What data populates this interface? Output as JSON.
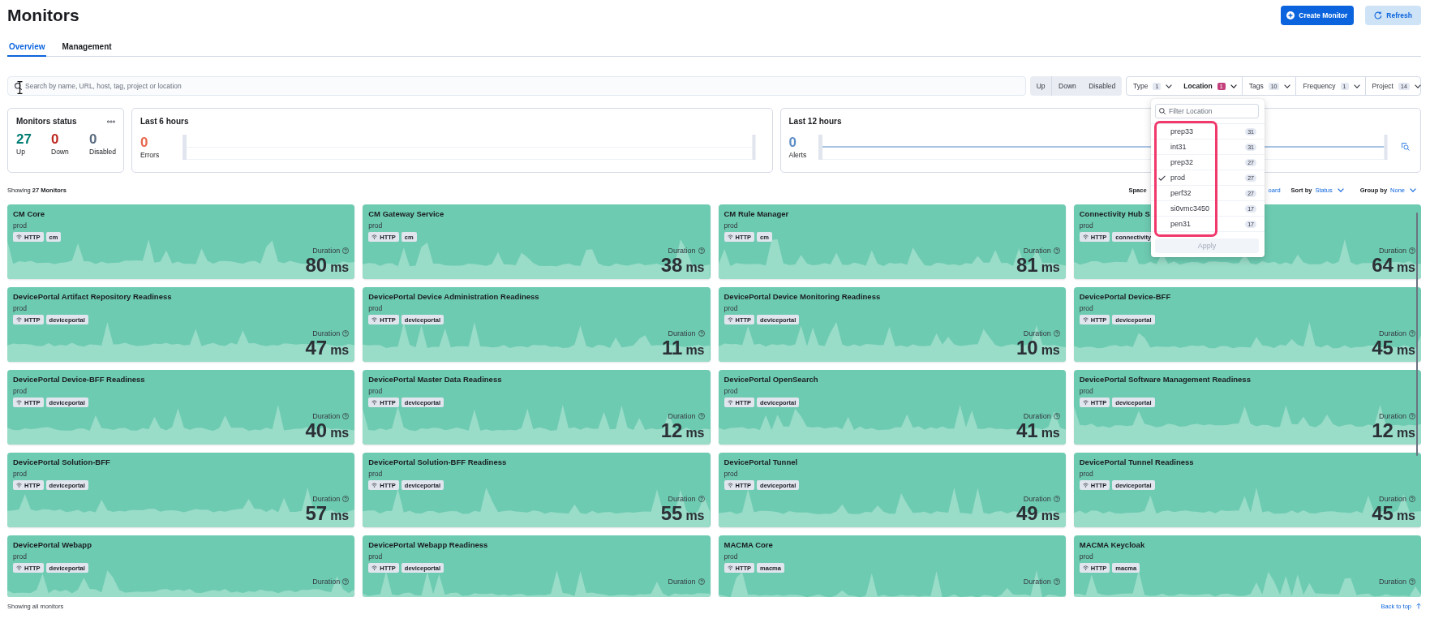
{
  "header": {
    "title": "Monitors",
    "buttons": [
      {
        "label": "Create Monitor",
        "kind": "create"
      },
      {
        "label": "Refresh",
        "kind": "refresh"
      }
    ]
  },
  "tabs": [
    {
      "label": "Overview",
      "selected": true
    },
    {
      "label": "Management",
      "selected": false
    }
  ],
  "search": {
    "placeholder": "Search by name, URL, host, tag, project or location",
    "text_cursor": true
  },
  "status_filters": [
    {
      "label": "Up",
      "selected": false
    },
    {
      "label": "Down",
      "selected": false
    },
    {
      "label": "Disabled",
      "selected": false
    }
  ],
  "filters": [
    {
      "label": "Type",
      "count": "1",
      "open": false
    },
    {
      "label": "Location",
      "count": "1",
      "open": true
    },
    {
      "label": "Tags",
      "count": "10",
      "open": false
    },
    {
      "label": "Frequency",
      "count": "1",
      "open": false
    },
    {
      "label": "Project",
      "count": "14",
      "open": false
    }
  ],
  "location_popover": {
    "placeholder": "Filter Location",
    "options": [
      {
        "label": "prep33",
        "count": "31",
        "checked": false
      },
      {
        "label": "int31",
        "count": "31",
        "checked": false
      },
      {
        "label": "prep32",
        "count": "27",
        "checked": false
      },
      {
        "label": "prod",
        "count": "27",
        "checked": true
      },
      {
        "label": "perf32",
        "count": "27",
        "checked": false
      },
      {
        "label": "si0vmc3450",
        "count": "17",
        "checked": false
      },
      {
        "label": "pen31",
        "count": "17",
        "checked": false
      }
    ],
    "highlight_frame": true,
    "apply_button": {
      "label": "Apply",
      "disabled": true
    }
  },
  "summary": {
    "status": {
      "title": "Monitors status",
      "counts": [
        {
          "value": "27",
          "label": "Up",
          "kind": "up"
        },
        {
          "value": "0",
          "label": "Down",
          "kind": "down"
        },
        {
          "value": "0",
          "label": "Disabled",
          "kind": "disabled"
        }
      ]
    },
    "panels": [
      {
        "title": "Last 6 hours",
        "value": "0",
        "label": "Errors",
        "kind": "errors"
      },
      {
        "title": "Last 12 hours",
        "value": "0",
        "label": "Alerts",
        "kind": "alerts"
      }
    ]
  },
  "toolbar": {
    "showing": "Showing **27 Monitors**",
    "spaces_label": "Space",
    "spaces_link": "oard",
    "sort_label": "Sort by",
    "sort_value": "Status",
    "group_label": "Group by",
    "group_value": "None"
  },
  "monitors": [
    {
      "name": "CM Core",
      "location": "prod",
      "type": "HTTP",
      "tags": [
        "cm"
      ],
      "up": true,
      "duration_label": "Duration",
      "duration": "80",
      "unit": "ms"
    },
    {
      "name": "CM Gateway Service",
      "location": "prod",
      "type": "HTTP",
      "tags": [
        "cm"
      ],
      "up": true,
      "duration_label": "Duration",
      "duration": "38",
      "unit": "ms"
    },
    {
      "name": "CM Rule Manager",
      "location": "prod",
      "type": "HTTP",
      "tags": [
        "cm"
      ],
      "up": true,
      "duration_label": "Duration",
      "duration": "81",
      "unit": "ms"
    },
    {
      "name": "Connectivity Hub S",
      "location": "prod",
      "type": "HTTP",
      "tags": [
        "connectivity"
      ],
      "up": true,
      "duration_label": "Duration",
      "duration": "64",
      "unit": "ms"
    },
    {
      "name": "DevicePortal Artifact Repository Readiness",
      "location": "prod",
      "type": "HTTP",
      "tags": [
        "deviceportal"
      ],
      "up": true,
      "duration_label": "Duration",
      "duration": "47",
      "unit": "ms"
    },
    {
      "name": "DevicePortal Device Administration Readiness",
      "location": "prod",
      "type": "HTTP",
      "tags": [
        "deviceportal"
      ],
      "up": true,
      "duration_label": "Duration",
      "duration": "11",
      "unit": "ms"
    },
    {
      "name": "DevicePortal Device Monitoring Readiness",
      "location": "prod",
      "type": "HTTP",
      "tags": [
        "deviceportal"
      ],
      "up": true,
      "duration_label": "Duration",
      "duration": "10",
      "unit": "ms"
    },
    {
      "name": "DevicePortal Device-BFF",
      "location": "prod",
      "type": "HTTP",
      "tags": [
        "deviceportal"
      ],
      "up": true,
      "duration_label": "Duration",
      "duration": "45",
      "unit": "ms"
    },
    {
      "name": "DevicePortal Device-BFF Readiness",
      "location": "prod",
      "type": "HTTP",
      "tags": [
        "deviceportal"
      ],
      "up": true,
      "duration_label": "Duration",
      "duration": "40",
      "unit": "ms"
    },
    {
      "name": "DevicePortal Master Data Readiness",
      "location": "prod",
      "type": "HTTP",
      "tags": [
        "deviceportal"
      ],
      "up": true,
      "duration_label": "Duration",
      "duration": "12",
      "unit": "ms"
    },
    {
      "name": "DevicePortal OpenSearch",
      "location": "prod",
      "type": "HTTP",
      "tags": [
        "deviceportal"
      ],
      "up": true,
      "duration_label": "Duration",
      "duration": "41",
      "unit": "ms"
    },
    {
      "name": "DevicePortal Software Management Readiness",
      "location": "prod",
      "type": "HTTP",
      "tags": [
        "deviceportal"
      ],
      "up": true,
      "duration_label": "Duration",
      "duration": "12",
      "unit": "ms"
    },
    {
      "name": "DevicePortal Solution-BFF",
      "location": "prod",
      "type": "HTTP",
      "tags": [
        "deviceportal"
      ],
      "up": true,
      "duration_label": "Duration",
      "duration": "57",
      "unit": "ms"
    },
    {
      "name": "DevicePortal Solution-BFF Readiness",
      "location": "prod",
      "type": "HTTP",
      "tags": [
        "deviceportal"
      ],
      "up": true,
      "duration_label": "Duration",
      "duration": "55",
      "unit": "ms"
    },
    {
      "name": "DevicePortal Tunnel",
      "location": "prod",
      "type": "HTTP",
      "tags": [
        "deviceportal"
      ],
      "up": true,
      "duration_label": "Duration",
      "duration": "49",
      "unit": "ms"
    },
    {
      "name": "DevicePortal Tunnel Readiness",
      "location": "prod",
      "type": "HTTP",
      "tags": [
        "deviceportal"
      ],
      "up": true,
      "duration_label": "Duration",
      "duration": "45",
      "unit": "ms"
    },
    {
      "name": "DevicePortal Webapp",
      "location": "prod",
      "type": "HTTP",
      "tags": [
        "deviceportal"
      ],
      "up": true,
      "duration_label": "Duration"
    },
    {
      "name": "DevicePortal Webapp Readiness",
      "location": "prod",
      "type": "HTTP",
      "tags": [
        "deviceportal"
      ],
      "up": true,
      "duration_label": "Duration"
    },
    {
      "name": "MACMA Core",
      "location": "prod",
      "type": "HTTP",
      "tags": [
        "macma"
      ],
      "up": true,
      "duration_label": "Duration"
    },
    {
      "name": "MACMA Keycloak",
      "location": "prod",
      "type": "HTTP",
      "tags": [
        "macma"
      ],
      "up": true,
      "duration_label": "Duration"
    }
  ],
  "footer": {
    "text": "Showing all monitors",
    "link": "Back to top"
  }
}
